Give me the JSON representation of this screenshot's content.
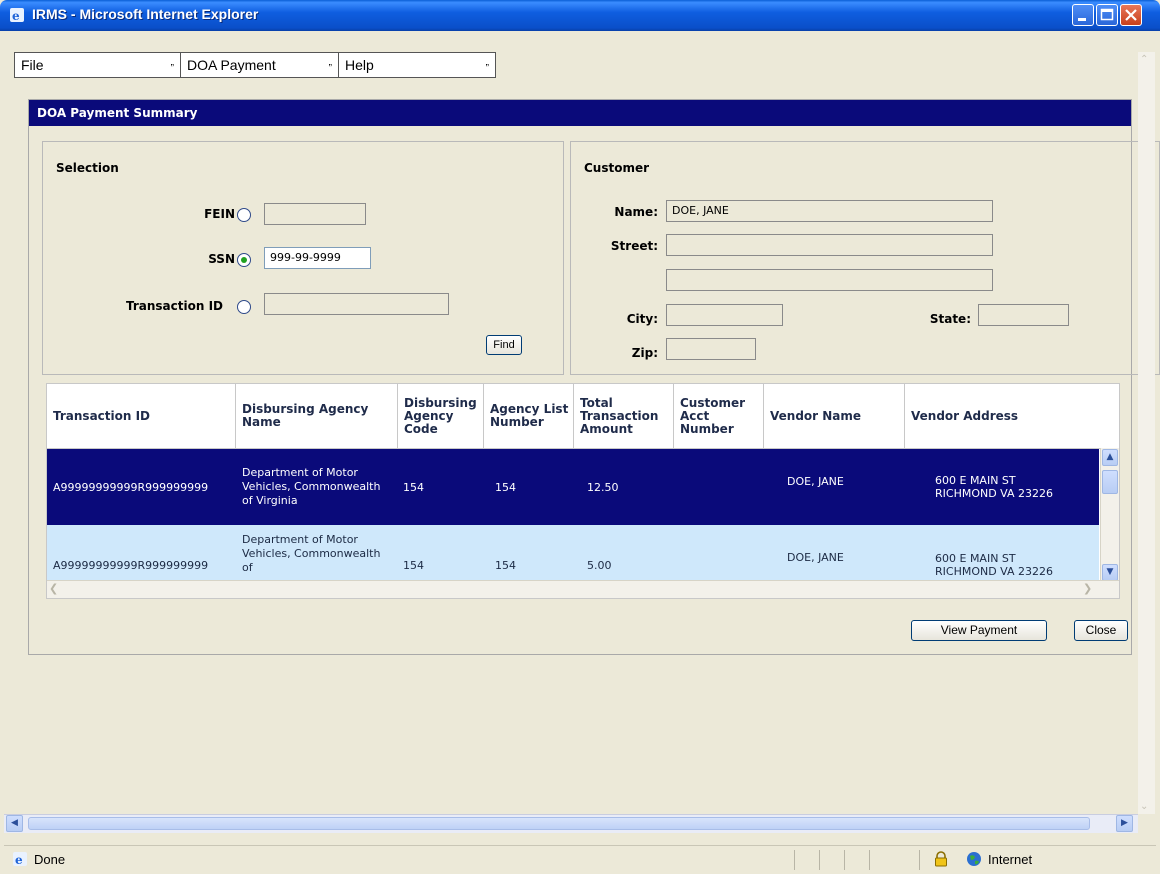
{
  "window": {
    "title": "IRMS - Microsoft Internet Explorer"
  },
  "menu": {
    "items": [
      {
        "label": "File"
      },
      {
        "label": "DOA Payment"
      },
      {
        "label": "Help"
      }
    ]
  },
  "panel": {
    "title": "DOA Payment Summary"
  },
  "selection": {
    "title": "Selection",
    "fein": {
      "label": "FEIN",
      "value": ""
    },
    "ssn": {
      "label": "SSN",
      "value": "999-99-9999"
    },
    "transaction_id": {
      "label": "Transaction ID",
      "value": ""
    },
    "selected": "SSN",
    "find_label": "Find"
  },
  "customer": {
    "title": "Customer",
    "name_label": "Name:",
    "name_value": "DOE, JANE",
    "street_label": "Street:",
    "street1": "",
    "street2": "",
    "city_label": "City:",
    "city": "",
    "state_label": "State:",
    "state": "",
    "zip_label": "Zip:",
    "zip": ""
  },
  "grid": {
    "columns": [
      "Transaction ID",
      "Disbursing Agency Name",
      "Disbursing Agency Code",
      "Agency List Number",
      "Total Transaction Amount",
      "Customer Acct Number",
      "Vendor Name",
      "Vendor Address"
    ],
    "rows": [
      {
        "transaction_id": "A99999999999R999999999",
        "agency_name": "Department of Motor Vehicles, Commonwealth of Virginia",
        "agency_code": "154",
        "list_number": "154",
        "amount": "12.50",
        "customer_acct": "",
        "vendor_name": "DOE, JANE",
        "vendor_addr1": "600 E MAIN ST",
        "vendor_addr2": "RICHMOND VA 23226"
      },
      {
        "transaction_id": "A99999999999R999999999",
        "agency_name": "Department of Motor Vehicles, Commonwealth of",
        "agency_code": "154",
        "list_number": "154",
        "amount": "5.00",
        "customer_acct": "",
        "vendor_name": "DOE, JANE",
        "vendor_addr1": "600 E MAIN ST",
        "vendor_addr2": "RICHMOND VA 23226"
      }
    ]
  },
  "buttons": {
    "view_payment": "View Payment",
    "close": "Close"
  },
  "status": {
    "text": "Done",
    "zone": "Internet"
  },
  "colors": {
    "header_blue": "#0a0a7a",
    "selected_row": "#0a0a7a",
    "alt_row": "#cfe8fb",
    "xp_title": "#0a5fd6"
  },
  "icons": [
    "ie-icon",
    "minimize-icon",
    "maximize-icon",
    "close-icon",
    "lock-icon",
    "globe-icon",
    "chevron-up-icon",
    "chevron-down-icon",
    "chevron-left-icon",
    "chevron-right-icon"
  ]
}
